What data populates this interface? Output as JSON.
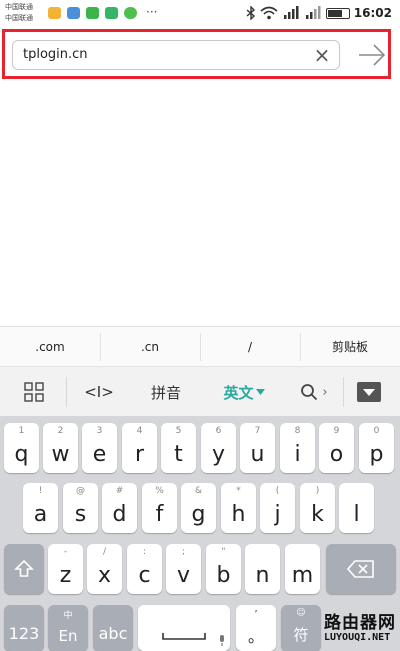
{
  "status_bar": {
    "carrier_1": "中国联通",
    "carrier_2": "中国联通",
    "more": "···",
    "clock": "16:02"
  },
  "address_bar": {
    "url": "tplogin.cn",
    "clear_symbol": "×",
    "highlight_color": "#e8232d"
  },
  "suggestion_bar": {
    "items": [
      ".com",
      ".cn",
      "/",
      "剪贴板"
    ]
  },
  "keyboard_toolbar": {
    "cursor_label": "<I>",
    "pinyin_label": "拼音",
    "english_label": "英文",
    "search_arrow": "›",
    "accent_color": "#2aa8a0"
  },
  "keyboard": {
    "row1": [
      {
        "hint": "1",
        "key": "q"
      },
      {
        "hint": "2",
        "key": "w"
      },
      {
        "hint": "3",
        "key": "e"
      },
      {
        "hint": "4",
        "key": "r"
      },
      {
        "hint": "5",
        "key": "t"
      },
      {
        "hint": "6",
        "key": "y"
      },
      {
        "hint": "7",
        "key": "u"
      },
      {
        "hint": "8",
        "key": "i"
      },
      {
        "hint": "9",
        "key": "o"
      },
      {
        "hint": "0",
        "key": "p"
      }
    ],
    "row2": [
      {
        "hint": "!",
        "key": "a"
      },
      {
        "hint": "@",
        "key": "s"
      },
      {
        "hint": "#",
        "key": "d"
      },
      {
        "hint": "%",
        "key": "f"
      },
      {
        "hint": "&",
        "key": "g"
      },
      {
        "hint": "*",
        "key": "h"
      },
      {
        "hint": "(",
        "key": "j"
      },
      {
        "hint": ")",
        "key": "k"
      },
      {
        "hint": "",
        "key": "l"
      }
    ],
    "row3": [
      {
        "hint": "-",
        "key": "z"
      },
      {
        "hint": "/",
        "key": "x"
      },
      {
        "hint": ":",
        "key": "c"
      },
      {
        "hint": ";",
        "key": "v"
      },
      {
        "hint": "\"",
        "key": "b"
      },
      {
        "hint": "",
        "key": "n"
      },
      {
        "hint": "",
        "key": "m"
      }
    ],
    "bottom": {
      "numbers_label": "123",
      "lang_hint": "中",
      "lang_label": "En",
      "abc_label": "abc",
      "punct_hint": "’",
      "punct_label": "。",
      "symbol_hint": "☺",
      "symbol_label": "符"
    }
  },
  "watermark": {
    "cn": "路由器网",
    "en": "LUYOUQI.NET"
  }
}
